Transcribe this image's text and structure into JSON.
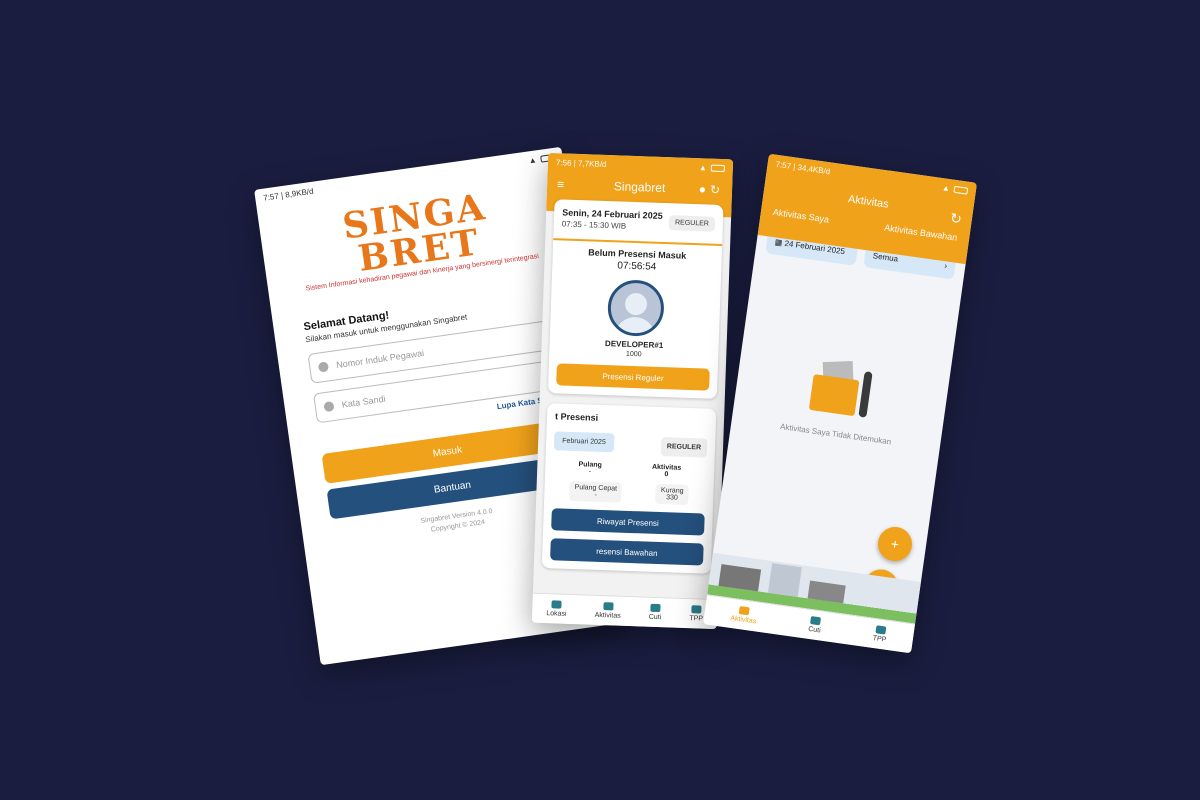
{
  "login": {
    "status_time": "7:57 | 8,9KB/d",
    "logo_line1": "SINGA",
    "logo_line2": "BRET",
    "logo_tagline": "Sistem Informasi kehadiran pegawai dan kinerja yang bersinergi terintegrasi",
    "welcome_title": "Selamat Datang!",
    "welcome_subtitle": "Silakan masuk untuk menggunakan Singabret",
    "nip_placeholder": "Nomor Induk Pegawai",
    "password_placeholder": "Kata Sandi",
    "forgot_link": "Lupa Kata Sandi ?",
    "login_button": "Masuk",
    "help_button": "Bantuan",
    "version": "Singabret Version 4.0.0",
    "copyright": "Copyright © 2024"
  },
  "home": {
    "status_time": "7:56 | 7,7KB/d",
    "app_title": "Singabret",
    "date": "Senin, 24 Februari 2025",
    "hours": "07:35 - 15:30 WIB",
    "shift_badge": "REGULER",
    "presence_status": "Belum Presensi Masuk",
    "clock": "07:56:54",
    "user_name": "DEVELOPER#1",
    "user_id": "1000",
    "presence_button": "Presensi Reguler",
    "section_title": "t Presensi",
    "section_date": "Februari 2025",
    "section_badge": "REGULER",
    "pulang_label": "Pulang",
    "pulang_value": "-",
    "aktivitas_label": "Aktivitas",
    "aktivitas_value": "0",
    "pulang_cepat_label": "Pulang Cepat",
    "pulang_cepat_value": "-",
    "kurang_label": "Kurang",
    "kurang_value": "330",
    "history_button": "Riwayat Presensi",
    "sub_button": "resensi Bawahan",
    "nav": [
      "Lokasi",
      "Aktivitas",
      "Cuti",
      "TPP"
    ]
  },
  "aktivitas": {
    "status_time": "7:57 | 34,4KB/d",
    "title": "Aktivitas",
    "tab_mine": "Aktivitas Saya",
    "tab_sub": "Aktivitas Bawahan",
    "date_filter": "24 Februari 2025",
    "scope_filter": "Semua",
    "empty_text": "Aktivitas Saya Tidak Ditemukan",
    "fab_add": "+",
    "fab_download": "⤓",
    "nav": [
      "Aktivitas",
      "Cuti",
      "TPP"
    ]
  },
  "colors": {
    "background": "#1a1d3f",
    "accent": "#f0a21a",
    "primary": "#24507d"
  }
}
